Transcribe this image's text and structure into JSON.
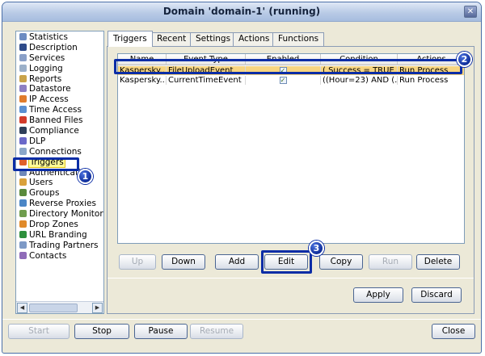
{
  "window": {
    "title": "Domain 'domain-1' (running)",
    "close_glyph": "✕"
  },
  "sidebar": {
    "items": [
      {
        "label": "Statistics",
        "icon": "chart-icon",
        "color": "#6d8cc2"
      },
      {
        "label": "Description",
        "icon": "person-icon",
        "color": "#2e4b8a"
      },
      {
        "label": "Services",
        "icon": "services-icon",
        "color": "#8aa0c8"
      },
      {
        "label": "Logging",
        "icon": "logging-icon",
        "color": "#9bb0c9"
      },
      {
        "label": "Reports",
        "icon": "reports-icon",
        "color": "#c9a34a"
      },
      {
        "label": "Datastore",
        "icon": "database-icon",
        "color": "#8d7fc2"
      },
      {
        "label": "IP Access",
        "icon": "ip-access-icon",
        "color": "#e07c2c"
      },
      {
        "label": "Time Access",
        "icon": "clock-icon",
        "color": "#5a8fd1"
      },
      {
        "label": "Banned Files",
        "icon": "banned-icon",
        "color": "#d23b2b"
      },
      {
        "label": "Compliance",
        "icon": "compliance-icon",
        "color": "#2f3f5a"
      },
      {
        "label": "DLP",
        "icon": "dlp-icon",
        "color": "#6a68c9"
      },
      {
        "label": "Connections",
        "icon": "connections-icon",
        "color": "#8aa6c9"
      },
      {
        "label": "Triggers",
        "icon": "triggers-icon",
        "color": "#e0602a"
      },
      {
        "label": "Authenticati",
        "icon": "auth-icon",
        "color": "#6f89b9"
      },
      {
        "label": "Users",
        "icon": "user-icon",
        "color": "#d9a13b"
      },
      {
        "label": "Groups",
        "icon": "group-icon",
        "color": "#5a8a3c"
      },
      {
        "label": "Reverse Proxies",
        "icon": "proxy-icon",
        "color": "#4a86c6"
      },
      {
        "label": "Directory Monitors",
        "icon": "folder-icon",
        "color": "#6f9d4e"
      },
      {
        "label": "Drop Zones",
        "icon": "dropzone-icon",
        "color": "#e08a2a"
      },
      {
        "label": "URL Branding",
        "icon": "globe-icon",
        "color": "#2d8f3c"
      },
      {
        "label": "Trading Partners",
        "icon": "partners-icon",
        "color": "#7d99c6"
      },
      {
        "label": "Contacts",
        "icon": "contacts-icon",
        "color": "#8f6bb8"
      }
    ],
    "scroll_left": "◀",
    "scroll_right": "▶"
  },
  "tabs": [
    "Triggers",
    "Recent",
    "Settings",
    "Actions",
    "Functions"
  ],
  "table": {
    "columns": [
      "Name",
      "Event Type",
      "Enabled",
      "Condition",
      "Actions"
    ],
    "rows": [
      [
        "Kaspersky...",
        "FileUploadEvent",
        "✓",
        "( Success = TRUE )",
        "Run Process"
      ],
      [
        "Kaspersky...",
        "CurrentTimeEvent",
        "✓",
        "((Hour=23) AND (...",
        "Run Process"
      ]
    ]
  },
  "buttons": {
    "up": "Up",
    "down": "Down",
    "add": "Add",
    "edit": "Edit",
    "copy": "Copy",
    "run": "Run",
    "delete": "Delete",
    "apply": "Apply",
    "discard": "Discard",
    "start": "Start",
    "stop": "Stop",
    "pause": "Pause",
    "resume": "Resume",
    "close": "Close"
  },
  "callouts": {
    "one": "1",
    "two": "2",
    "three": "3"
  },
  "colors": {
    "callout": "#0b2da6",
    "selection": "#f7d581",
    "title_bar": "#b9cbe6"
  }
}
